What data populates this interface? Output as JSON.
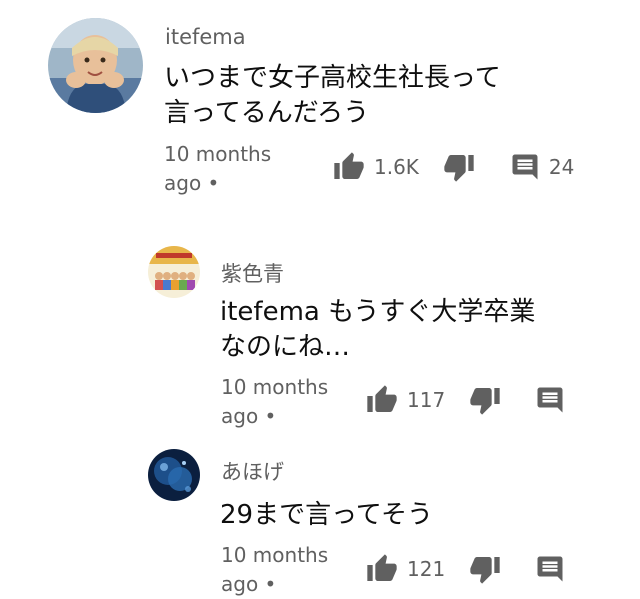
{
  "comments": [
    {
      "author": "itefema",
      "text_line1": "いつまで女子高校生社長って",
      "text_line2": "言ってるんだろう",
      "time_line1": "10 months",
      "time_line2": "ago •",
      "likes": "1.6K",
      "replies": "24",
      "icons": [
        "thumb-up-icon",
        "thumb-down-icon",
        "comment-icon"
      ]
    },
    {
      "author": "紫色青",
      "mention": "itefema",
      "text_line1": " もうすぐ大学卒業",
      "text_line2": "なのにね…",
      "time_line1": "10 months",
      "time_line2": "ago •",
      "likes": "117",
      "icons": [
        "thumb-up-icon",
        "thumb-down-icon",
        "comment-icon"
      ]
    },
    {
      "author": "あほげ",
      "text_line1": "29まで言ってそう",
      "time_line1": "10 months",
      "time_line2": "ago •",
      "likes": "121",
      "icons": [
        "thumb-up-icon",
        "thumb-down-icon",
        "comment-icon"
      ]
    }
  ],
  "colors": {
    "secondary_text": "#606060",
    "primary_text": "#0f0f0f",
    "icon": "#606060"
  }
}
